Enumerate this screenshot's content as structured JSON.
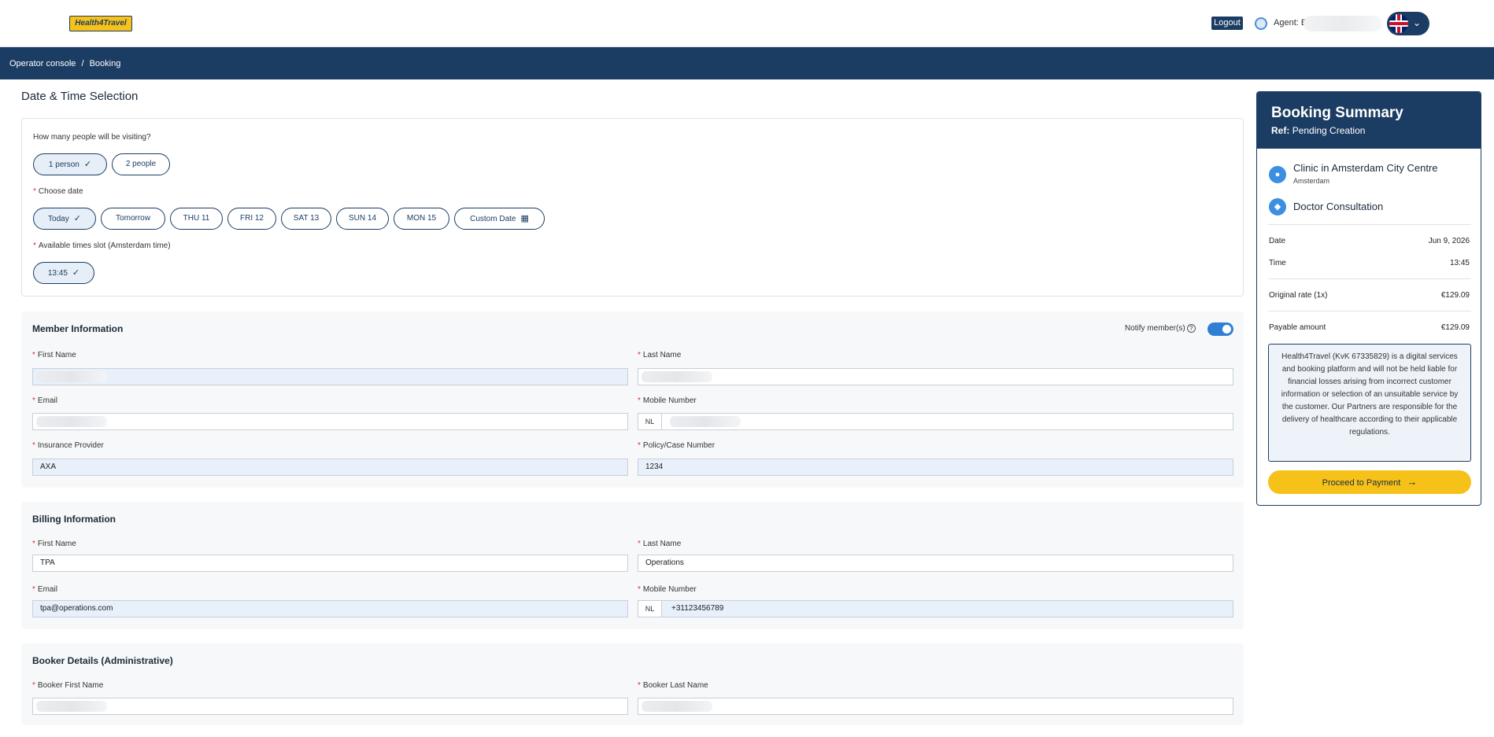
{
  "header": {
    "logo_text": "Health4Travel",
    "logout_label": "Logout",
    "agent_label": "Agent: E",
    "lang_chevron": "⌄"
  },
  "breadcrumb": {
    "items": [
      "Operator console",
      "Booking"
    ],
    "separator": "/"
  },
  "date_time": {
    "title": "Date & Time Selection",
    "people_question": "How many people will be visiting?",
    "people_options": [
      "1 person",
      "2 people"
    ],
    "date_label": "Choose date",
    "date_options": [
      "Today",
      "Tomorrow",
      "THU 11",
      "FRI 12",
      "SAT 13",
      "SUN 14",
      "MON 15",
      "Custom Date"
    ],
    "time_label": "Available times slot (Amsterdam time)",
    "time_options": [
      "13:45"
    ]
  },
  "member": {
    "title": "Member Information",
    "notify_label": "Notify member(s)",
    "first_name_label": "First Name",
    "last_name_label": "Last Name",
    "email_label": "Email",
    "mobile_label": "Mobile Number",
    "mobile_cc": "NL",
    "insurance_label": "Insurance Provider",
    "insurance_value": "AXA",
    "policy_label": "Policy/Case Number",
    "policy_value": "1234"
  },
  "billing": {
    "title": "Billing Information",
    "first_name_label": "First Name",
    "first_name_value": "TPA",
    "last_name_label": "Last Name",
    "last_name_value": "Operations",
    "email_label": "Email",
    "email_value": "tpa@operations.com",
    "mobile_label": "Mobile Number",
    "mobile_cc": "NL",
    "mobile_value": "+31123456789"
  },
  "booker": {
    "title": "Booker Details (Administrative)",
    "first_name_label": "Booker First Name",
    "last_name_label": "Booker Last Name"
  },
  "summary": {
    "title": "Booking Summary",
    "ref_label": "Ref:",
    "ref_value": "Pending Creation",
    "clinic": "Clinic in Amsterdam City Centre",
    "city": "Amsterdam",
    "service": "Doctor Consultation",
    "date_label": "Date",
    "date_value": "Jun 9, 2026",
    "time_label": "Time",
    "time_value": "13:45",
    "original_rate_label": "Original rate (1x)",
    "original_rate_value": "€129.09",
    "payable_label": "Payable amount",
    "payable_value": "€129.09",
    "disclaimer": "Health4Travel (KvK 67335829) is a digital services and booking platform and will not be held liable for financial losses arising from incorrect customer information or selection of an unsuitable service by the customer. Our Partners are responsible for the delivery of healthcare according to their applicable regulations.",
    "proceed_label": "Proceed to Payment"
  },
  "colors": {
    "brand_navy": "#1c3d63",
    "accent_yellow": "#f6c21a",
    "toggle_blue": "#2f7fd5"
  }
}
